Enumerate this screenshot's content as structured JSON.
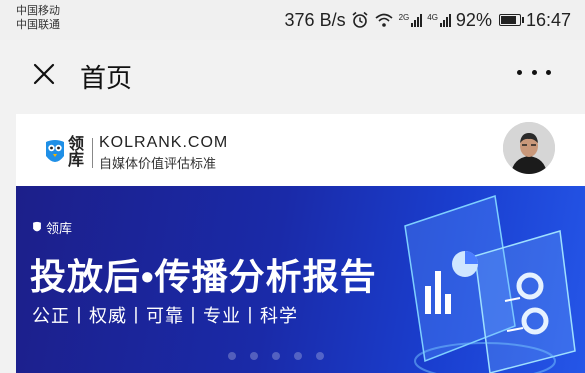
{
  "status_bar": {
    "carrier_1": "中国移动",
    "carrier_2": "中国联通",
    "net_speed": "376 B/s",
    "signal_1_label": "2G",
    "signal_2_label": "4G",
    "battery": "92%",
    "time": "16:47"
  },
  "nav": {
    "title": "首页"
  },
  "header": {
    "logo_cn": "领库",
    "logo_domain": "KOLRANK.COM",
    "logo_tagline": "自媒体价值评估标准"
  },
  "banner": {
    "brand": "领库",
    "title": "投放后•传播分析报告",
    "subtitle": "公正丨权威丨可靠丨专业丨科学"
  },
  "colors": {
    "banner_bg": "#1a2aa8",
    "accent_cyan": "#3fd0ff"
  }
}
